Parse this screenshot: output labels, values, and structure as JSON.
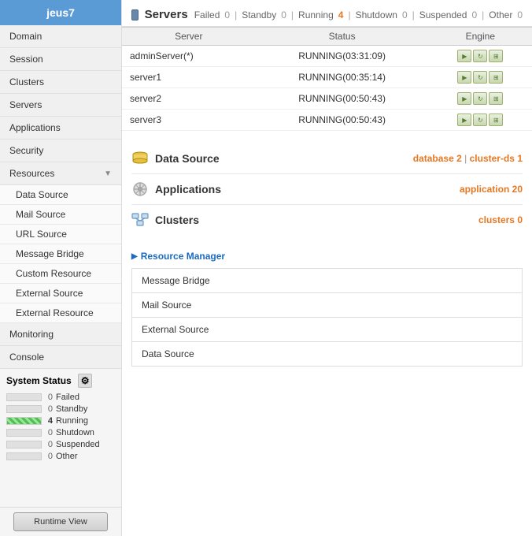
{
  "sidebar": {
    "title": "jeus7",
    "nav_items": [
      {
        "id": "domain",
        "label": "Domain"
      },
      {
        "id": "session",
        "label": "Session"
      },
      {
        "id": "clusters",
        "label": "Clusters"
      },
      {
        "id": "servers",
        "label": "Servers"
      },
      {
        "id": "applications",
        "label": "Applications"
      },
      {
        "id": "security",
        "label": "Security"
      }
    ],
    "resources_label": "Resources",
    "resources_sub": [
      {
        "id": "data-source",
        "label": "Data Source"
      },
      {
        "id": "mail-source",
        "label": "Mail Source"
      },
      {
        "id": "url-source",
        "label": "URL Source"
      },
      {
        "id": "message-bridge",
        "label": "Message Bridge"
      },
      {
        "id": "custom-resource",
        "label": "Custom Resource"
      },
      {
        "id": "external-source",
        "label": "External Source"
      },
      {
        "id": "external-resource",
        "label": "External Resource"
      }
    ],
    "monitoring_label": "Monitoring",
    "console_label": "Console",
    "system_status": {
      "title": "System Status",
      "rows": [
        {
          "count": "0",
          "label": "Failed",
          "has_bar": false
        },
        {
          "count": "0",
          "label": "Standby",
          "has_bar": false
        },
        {
          "count": "4",
          "label": "Running",
          "has_bar": true
        },
        {
          "count": "0",
          "label": "Shutdown",
          "has_bar": false
        },
        {
          "count": "0",
          "label": "Suspended",
          "has_bar": false
        },
        {
          "count": "0",
          "label": "Other",
          "has_bar": false
        }
      ]
    },
    "runtime_btn": "Runtime View"
  },
  "servers_section": {
    "title": "Servers",
    "status_items": [
      {
        "label": "Failed",
        "count": "0",
        "nonzero": false
      },
      {
        "label": "Standby",
        "count": "0",
        "nonzero": false
      },
      {
        "label": "Running",
        "count": "4",
        "nonzero": true
      },
      {
        "label": "Shutdown",
        "count": "0",
        "nonzero": false
      },
      {
        "label": "Suspended",
        "count": "0",
        "nonzero": false
      },
      {
        "label": "Other",
        "count": "0",
        "nonzero": false
      }
    ],
    "table_headers": [
      "Server",
      "Status",
      "Engine"
    ],
    "rows": [
      {
        "server": "adminServer(*)",
        "status": "RUNNING(03:31:09)"
      },
      {
        "server": "server1",
        "status": "RUNNING(00:35:14)"
      },
      {
        "server": "server2",
        "status": "RUNNING(00:50:43)"
      },
      {
        "server": "server3",
        "status": "RUNNING(00:50:43)"
      }
    ]
  },
  "data_cards": [
    {
      "id": "data-source",
      "title": "Data Source",
      "stat_label": "database",
      "stat_count": "2",
      "stat2_label": "cluster-ds",
      "stat2_count": "1",
      "icon_type": "db"
    },
    {
      "id": "applications",
      "title": "Applications",
      "stat_label": "application",
      "stat_count": "20",
      "icon_type": "gear"
    },
    {
      "id": "clusters",
      "title": "Clusters",
      "stat_label": "clusters",
      "stat_count": "0",
      "icon_type": "cluster"
    }
  ],
  "resource_manager": {
    "title": "Resource Manager",
    "items": [
      {
        "id": "message-bridge",
        "label": "Message Bridge"
      },
      {
        "id": "mail-source",
        "label": "Mail Source"
      },
      {
        "id": "external-source",
        "label": "External Source"
      },
      {
        "id": "data-source",
        "label": "Data Source"
      }
    ]
  }
}
